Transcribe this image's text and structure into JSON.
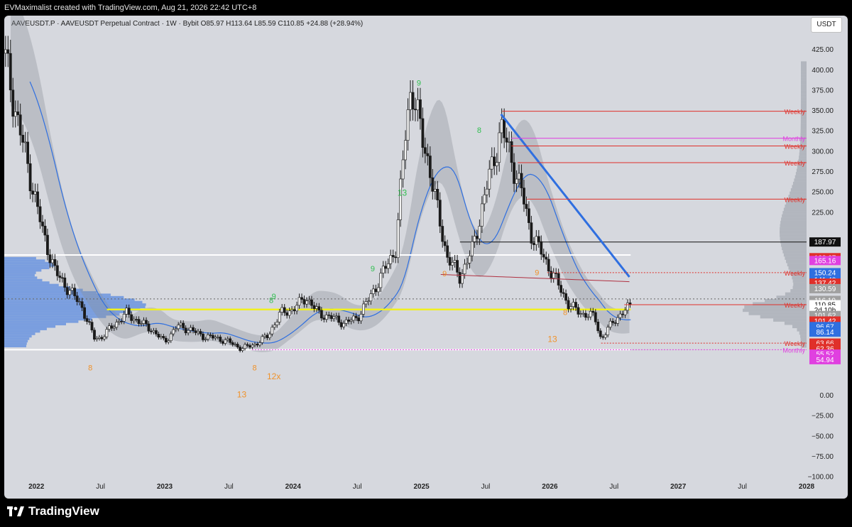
{
  "header": {
    "credit": "EVMaximalist created with TradingView.com, Aug 21, 2026 22:42 UTC+8"
  },
  "symbol_line": "AAVEUSDT.P · AAVEUSDT Perpetual Contract · 1W · Bybit  O85.97  H113.64  L85.59  C110.85  +24.88 (+28.94%)",
  "unit_button": "USDT",
  "brand": {
    "name": "TradingView"
  },
  "colors": {
    "panel_bg": "#d6d8de",
    "candle": "#1a1a1a",
    "resistance": "#e0302a",
    "monthly": "#e040e0",
    "support": "#f0f020",
    "ma_blue": "#2f6fe0",
    "ma_red": "#b03040",
    "td_green": "#2fbf4f",
    "td_orange": "#f0922a"
  },
  "chart_data": {
    "type": "candlestick",
    "title": "AAVEUSDT.P · AAVEUSDT Perpetual Contract · 1W · Bybit",
    "ohlc_last": {
      "open": 85.97,
      "high": 113.64,
      "low": 85.59,
      "close": 110.85,
      "change": 24.88,
      "change_pct": 28.94
    },
    "x_range": [
      2021.75,
      2028.0
    ],
    "ylim": [
      -110,
      440
    ],
    "y_ticks": [
      425,
      400,
      375,
      350,
      325,
      300,
      275,
      250,
      225,
      0,
      -25,
      -50,
      -75,
      -100
    ],
    "y_tick_labels": [
      "425.00",
      "400.00",
      "375.00",
      "350.00",
      "325.00",
      "300.00",
      "275.00",
      "250.00",
      "225.00",
      "0.00",
      "−25.00",
      "−50.00",
      "−75.00",
      "−100.00"
    ],
    "x_ticks": [
      {
        "label": "2022",
        "x": 2022.0,
        "bold": true
      },
      {
        "label": "Jul",
        "x": 2022.5,
        "bold": false
      },
      {
        "label": "2023",
        "x": 2023.0,
        "bold": true
      },
      {
        "label": "Jul",
        "x": 2023.5,
        "bold": false
      },
      {
        "label": "2024",
        "x": 2024.0,
        "bold": true
      },
      {
        "label": "Jul",
        "x": 2024.5,
        "bold": false
      },
      {
        "label": "2025",
        "x": 2025.0,
        "bold": true
      },
      {
        "label": "Jul",
        "x": 2025.5,
        "bold": false
      },
      {
        "label": "2026",
        "x": 2026.0,
        "bold": true
      },
      {
        "label": "Jul",
        "x": 2026.5,
        "bold": false
      },
      {
        "label": "2027",
        "x": 2027.0,
        "bold": true
      },
      {
        "label": "Jul",
        "x": 2027.5,
        "bold": false
      },
      {
        "label": "2028",
        "x": 2028.0,
        "bold": true
      }
    ],
    "price_series": [
      [
        2021.75,
        420
      ],
      [
        2021.85,
        340
      ],
      [
        2021.95,
        270
      ],
      [
        2022.05,
        200
      ],
      [
        2022.15,
        150
      ],
      [
        2022.25,
        130
      ],
      [
        2022.35,
        110
      ],
      [
        2022.45,
        70
      ],
      [
        2022.5,
        70
      ],
      [
        2022.6,
        85
      ],
      [
        2022.7,
        100
      ],
      [
        2022.8,
        90
      ],
      [
        2022.9,
        80
      ],
      [
        2023.0,
        65
      ],
      [
        2023.1,
        85
      ],
      [
        2023.2,
        80
      ],
      [
        2023.3,
        72
      ],
      [
        2023.4,
        70
      ],
      [
        2023.5,
        65
      ],
      [
        2023.6,
        57
      ],
      [
        2023.7,
        62
      ],
      [
        2023.8,
        72
      ],
      [
        2023.9,
        100
      ],
      [
        2024.0,
        105
      ],
      [
        2024.1,
        120
      ],
      [
        2024.2,
        100
      ],
      [
        2024.3,
        95
      ],
      [
        2024.4,
        88
      ],
      [
        2024.5,
        95
      ],
      [
        2024.6,
        120
      ],
      [
        2024.7,
        150
      ],
      [
        2024.8,
        180
      ],
      [
        2024.88,
        330
      ],
      [
        2024.92,
        380
      ],
      [
        2025.0,
        320
      ],
      [
        2025.05,
        290
      ],
      [
        2025.12,
        230
      ],
      [
        2025.2,
        170
      ],
      [
        2025.3,
        145
      ],
      [
        2025.4,
        180
      ],
      [
        2025.5,
        250
      ],
      [
        2025.58,
        300
      ],
      [
        2025.62,
        330
      ],
      [
        2025.7,
        290
      ],
      [
        2025.78,
        250
      ],
      [
        2025.85,
        200
      ],
      [
        2025.95,
        170
      ],
      [
        2026.05,
        140
      ],
      [
        2026.15,
        110
      ],
      [
        2026.25,
        100
      ],
      [
        2026.35,
        96
      ],
      [
        2026.4,
        68
      ],
      [
        2026.5,
        92
      ],
      [
        2026.58,
        102
      ],
      [
        2026.63,
        110.85
      ]
    ],
    "annotations": [
      {
        "text": "Weekly",
        "price": 348.7,
        "color": "#e0302a",
        "label": "348.70",
        "line_start": 2025.63
      },
      {
        "text": "Monthly",
        "price": 315.46,
        "color": "#e040e0",
        "label": "315.46",
        "line_start": 2025.7
      },
      {
        "text": "Weekly",
        "price": 306.04,
        "color": "#e0302a",
        "label": "306.04",
        "line_start": 2025.7
      },
      {
        "text": "Weekly",
        "price": 285.46,
        "color": "#e0302a",
        "label": "285.46",
        "line_start": 2025.75
      },
      {
        "text": "Weekly",
        "price": 240.64,
        "color": "#e0302a",
        "label": "240.64",
        "line_start": 2025.82
      },
      {
        "text": "Weekly",
        "price": 150.24,
        "color": "#e0302a",
        "label": "150.24",
        "line_start": 2025.98,
        "dotted": true
      },
      {
        "text": "Weekly",
        "price": 110.85,
        "color": "#e0302a",
        "label": "110.85",
        "line_start": 2026.58
      },
      {
        "text": "Weekly",
        "price": 63.66,
        "color": "#e0302a",
        "label": "63.66",
        "line_start": 2026.4,
        "dotted": true
      },
      {
        "text": "Monthly",
        "price": 55.52,
        "color": "#e040e0",
        "label": "55.52",
        "line_start": 2023.68,
        "dotted": true
      }
    ],
    "price_tags": [
      {
        "label": "187.97",
        "value": 187.97,
        "bg": "#111111"
      },
      {
        "label": "168.67",
        "value": 168.67,
        "bg": "#e0302a"
      },
      {
        "label": "165.16",
        "value": 165.16,
        "bg": "#e040e0"
      },
      {
        "label": "150.24",
        "value": 150.24,
        "bg": "#2f6fe0"
      },
      {
        "label": "141.40",
        "value": 141.4,
        "bg": "#2f6fe0"
      },
      {
        "label": "137.42",
        "value": 137.42,
        "bg": "#e0302a"
      },
      {
        "label": "130.59",
        "value": 130.59,
        "bg": "#a0a0a0"
      },
      {
        "label": "116.10",
        "value": 116.1,
        "bg": "#a0a0a0"
      },
      {
        "label": "110.85",
        "value": 110.85,
        "bg": "#ffffff",
        "fg": "#111111"
      },
      {
        "label": "2d 10h",
        "value": 104.2,
        "bg": "#ffffff",
        "fg": "#111111"
      },
      {
        "label": "101.62",
        "value": 97.6,
        "bg": "#a0a0a0"
      },
      {
        "label": "101.42",
        "value": 90.8,
        "bg": "#e0302a"
      },
      {
        "label": "96.67",
        "value": 84.0,
        "bg": "#2f6fe0"
      },
      {
        "label": "86.14",
        "value": 77.2,
        "bg": "#2f6fe0"
      },
      {
        "label": "63.66",
        "value": 63.66,
        "bg": "#e0302a"
      },
      {
        "label": "62.36",
        "value": 56.9,
        "bg": "#e0302a"
      },
      {
        "label": "55.52",
        "value": 50.1,
        "bg": "#e040e0"
      },
      {
        "label": "54.94",
        "value": 43.3,
        "bg": "#e040e0"
      }
    ],
    "horizontal_levels": [
      {
        "name": "upper-box-line",
        "price": 172,
        "color": "#ffffff",
        "x_from": 2021.75,
        "x_to": 2026.63
      },
      {
        "name": "support-yellow",
        "price": 105,
        "color": "#f0f020",
        "x_from": 2022.55,
        "x_to": 2026.63
      },
      {
        "name": "lower-box-line",
        "price": 55.5,
        "color": "#ffffff",
        "x_from": 2021.75,
        "x_to": 2026.63
      },
      {
        "name": "black-level",
        "price": 187.97,
        "color": "#111111",
        "x_from": 2025.3,
        "x_to": 2028.0
      },
      {
        "name": "current-price",
        "price": 118,
        "color": "#666666",
        "x_from": 2021.75,
        "x_to": 2028.0,
        "dotted": true
      }
    ],
    "td_labels": [
      {
        "text": "9",
        "x": 2024.98,
        "price": 380,
        "color": "#2fbf4f"
      },
      {
        "text": "8",
        "x": 2025.45,
        "price": 322,
        "color": "#2fbf4f"
      },
      {
        "text": "13",
        "x": 2024.85,
        "price": 245,
        "color": "#2fbf4f"
      },
      {
        "text": "9",
        "x": 2024.62,
        "price": 152,
        "color": "#2fbf4f"
      },
      {
        "text": "9",
        "x": 2023.85,
        "price": 118,
        "color": "#2fbf4f"
      },
      {
        "text": "8",
        "x": 2023.83,
        "price": 113,
        "color": "#2fbf4f"
      },
      {
        "text": "9",
        "x": 2025.18,
        "price": 146,
        "color": "#f0922a"
      },
      {
        "text": "9",
        "x": 2025.9,
        "price": 147,
        "color": "#f0922a"
      },
      {
        "text": "8",
        "x": 2026.12,
        "price": 98,
        "color": "#f0922a"
      },
      {
        "text": "13",
        "x": 2026.02,
        "price": 65,
        "color": "#f0922a"
      },
      {
        "text": "8",
        "x": 2022.42,
        "price": 30,
        "color": "#f0922a"
      },
      {
        "text": "8",
        "x": 2023.7,
        "price": 30,
        "color": "#f0922a"
      },
      {
        "text": "13",
        "x": 2023.6,
        "price": -3,
        "color": "#f0922a"
      },
      {
        "text": "12x",
        "x": 2023.85,
        "price": 19,
        "color": "#f0922a"
      }
    ]
  }
}
